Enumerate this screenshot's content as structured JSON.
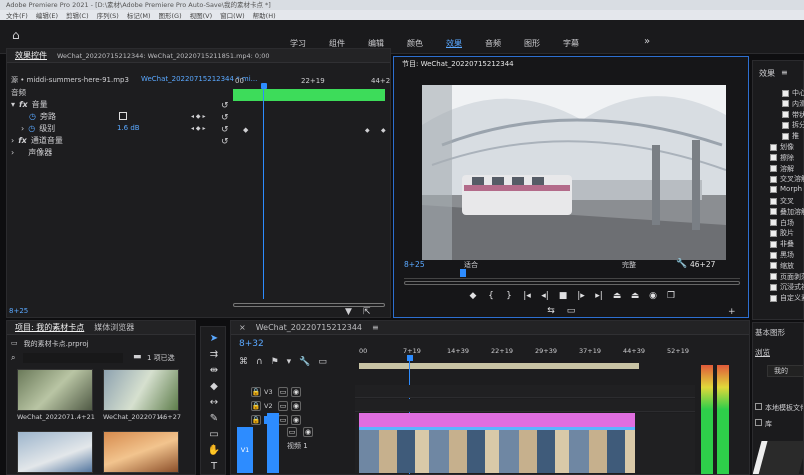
{
  "titlebar": {
    "text": "Adobe Premiere Pro 2021 - [D:\\素材\\Adobe Premiere Pro Auto-Save\\我的素材卡点 *]",
    "menu": [
      "文件(F)",
      "编辑(E)",
      "剪辑(C)",
      "序列(S)",
      "标记(M)",
      "图形(G)",
      "视图(V)",
      "窗口(W)",
      "帮助(H)"
    ]
  },
  "workspaces": {
    "items": [
      "学习",
      "组件",
      "编辑",
      "颜色",
      "效果",
      "音频",
      "图形",
      "字幕"
    ],
    "active": "效果",
    "more": "»"
  },
  "effect_controls": {
    "tab_label": "效果控件",
    "tab2_label": "WeChat_20220715212344: WeChat_20220715211851.mp4: 0;00",
    "source_label": "源 • middi-summers-here-91.mp3",
    "seq_label": "WeChat_20220715212344 * mi...",
    "audio_section": "音频",
    "ruler": [
      "00",
      "22+19",
      "44+2"
    ],
    "rows": [
      {
        "label": "音量",
        "fx": "fx"
      },
      {
        "label": "旁路",
        "value": ""
      },
      {
        "label": "级别",
        "value": "1.6 dB"
      },
      {
        "label": "通道音量",
        "fx": "fx"
      },
      {
        "label": "声像器",
        "fx": ""
      }
    ],
    "timecode": "8+25"
  },
  "program": {
    "title": "节目: WeChat_20220715212344",
    "timecode_left": "8+25",
    "fit": "适合",
    "quality": "完整",
    "timecode_right": "46+27"
  },
  "project": {
    "tab_label": "项目: 我的素材卡点",
    "tab2_label": "媒体浏览器",
    "file": "我的素材卡点.prproj",
    "selected": "1 项已选",
    "items": [
      {
        "name": "WeChat_2022071...",
        "dur": "4+21"
      },
      {
        "name": "WeChat_2022071...",
        "dur": "46+27"
      }
    ]
  },
  "timeline": {
    "tab_label": "WeChat_20220715212344",
    "timecode": "8+32",
    "ruler": [
      "00",
      "7+19",
      "14+39",
      "22+19",
      "29+39",
      "37+19",
      "44+39",
      "52+19"
    ],
    "tracks": [
      {
        "name": "V3"
      },
      {
        "name": "V2"
      },
      {
        "name": "V1"
      },
      {
        "name": "视频 1"
      }
    ],
    "source_patch": "V1"
  },
  "effects_panel": {
    "title": "效果",
    "items": [
      "中心",
      "内滑",
      "带状",
      "拆分",
      "推",
      "划像",
      "擦除",
      "溶解",
      "交叉溶解",
      "Morph",
      "交叉",
      "叠加溶解",
      "白场",
      "胶片",
      "非叠",
      "黑场",
      "缩放",
      "页面剥落",
      "沉浸式视频",
      "自定义素材"
    ],
    "essential_title": "基本图形",
    "browse_tab": "浏览",
    "my_templates": "我的",
    "local_checkbox": "本地模板文件夹",
    "lib": "库"
  },
  "colors": {
    "accent": "#2d8cff",
    "audio_clip": "#3ddc5a",
    "video_clip": "#e06ee0"
  }
}
